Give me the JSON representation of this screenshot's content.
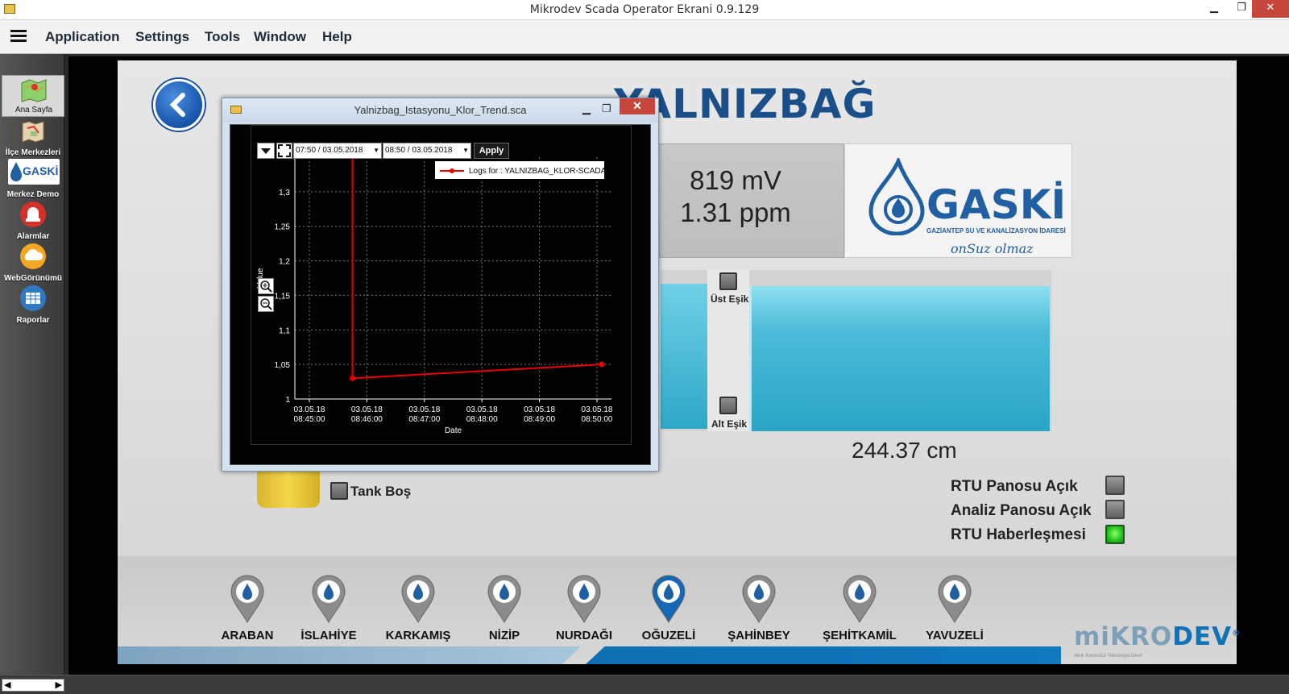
{
  "window": {
    "title": "Mikrodev Scada Operator Ekrani 0.9.129",
    "min_glyph": "▁",
    "max_glyph": "❐",
    "close_glyph": "✕"
  },
  "menu": [
    "Application",
    "Settings",
    "Tools",
    "Window",
    "Help"
  ],
  "sidebar": {
    "items": [
      {
        "label": "Ana Sayfa",
        "icon": "map-icon",
        "active": true
      },
      {
        "label": "İlçe Merkezleri",
        "icon": "district-map-icon"
      },
      {
        "label": "Merkez Demo",
        "icon": "gaski-logo-icon",
        "logo_text": "GASKİ"
      },
      {
        "label": "Alarmlar",
        "icon": "alarm-siren-icon"
      },
      {
        "label": "WebGörünümü",
        "icon": "cloud-icon"
      },
      {
        "label": "Raporlar",
        "icon": "report-icon"
      }
    ]
  },
  "scada": {
    "station_title": "YALNIZBAĞ",
    "readout_mv": "819 mV",
    "readout_ppm": "1.31 ppm",
    "gaski_logo": {
      "word": "GASKİ",
      "subtitle": "GAZİANTEP SU VE KANALİZASYON İDARESİ",
      "slogan": "onSuz olmaz"
    },
    "upper_threshold_label": "Üst Eşik",
    "lower_threshold_label": "Alt Eşik",
    "tank_level": "244.37 cm",
    "tank_empty_label": "Tank Boş",
    "status": [
      {
        "label": "RTU Panosu Açık",
        "state": "off"
      },
      {
        "label": "Analiz Panosu Açık",
        "state": "off"
      },
      {
        "label": "RTU Haberleşmesi",
        "state": "on"
      }
    ],
    "stations": [
      "ARABAN",
      "İSLAHİYE",
      "KARKAMIŞ",
      "NİZİP",
      "NURDAĞI",
      "OĞUZELİ",
      "ŞAHİNBEY",
      "ŞEHİTKAMİL",
      "YAVUZELİ"
    ],
    "active_station": "OĞUZELİ",
    "brand": {
      "part1": "mi",
      "part2": "KRO",
      "part3": "DEV",
      "reg": "®",
      "tagline": "Akıllı Kontrolcü Teknolojisi Devri"
    },
    "colors": {
      "water": "#2aa5c6",
      "title": "#1a4f8a",
      "active_pin": "#1667b8",
      "status_on": "#20c51a"
    }
  },
  "trend_window": {
    "title": "Yalnizbag_Istasyonu_Klor_Trend.sca",
    "start_datetime": "07:50 / 03.05.2018",
    "end_datetime": "08:50 / 03.05.2018",
    "apply_label": "Apply",
    "legend": "Logs for : YALNIZBAG_KLOR-SCADA",
    "zoom_in_icon": "zoom-in-icon",
    "zoom_out_icon": "zoom-out-icon"
  },
  "chart_data": {
    "type": "line",
    "title": "",
    "xlabel": "Date",
    "ylabel": "Value",
    "ylim": [
      1,
      1.35
    ],
    "yticks": [
      "1",
      "1,05",
      "1,1",
      "1,15",
      "1,2",
      "1,25",
      "1,3"
    ],
    "xticks": [
      {
        "date": "03.05.18",
        "time": "08:45:00"
      },
      {
        "date": "03.05.18",
        "time": "08:46:00"
      },
      {
        "date": "03.05.18",
        "time": "08:47:00"
      },
      {
        "date": "03.05.18",
        "time": "08:48:00"
      },
      {
        "date": "03.05.18",
        "time": "08:49:00"
      },
      {
        "date": "03.05.18",
        "time": "08:50:00"
      }
    ],
    "series": [
      {
        "name": "Logs for : YALNIZBAG_KLOR-SCADA",
        "color": "#e60000",
        "points": [
          {
            "t": "08:45:45",
            "y": 1.37
          },
          {
            "t": "08:45:45",
            "y": 1.03
          },
          {
            "t": "08:50:05",
            "y": 1.05
          }
        ]
      }
    ],
    "grid": true,
    "legend_position": "top-right"
  }
}
